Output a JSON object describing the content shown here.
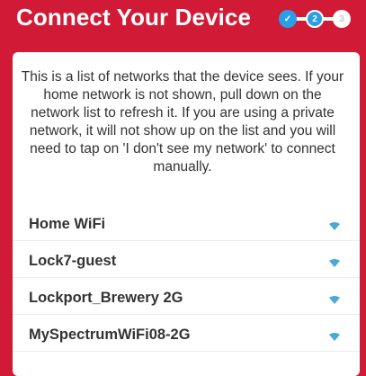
{
  "header": {
    "title": "Connect Your Device",
    "steps": [
      "✓",
      "2",
      "3"
    ]
  },
  "intro_text": "This is a list of networks that the device sees. If your home network is not shown, pull down on the network list to refresh it. If you are using a private network, it will not show up on the list and you will need to tap on 'I don't see my network' to connect manually.",
  "networks": [
    {
      "name": "Home WiFi",
      "icon": "wifi-signal-icon"
    },
    {
      "name": "Lock7-guest",
      "icon": "wifi-signal-icon"
    },
    {
      "name": "Lockport_Brewery 2G",
      "icon": "wifi-signal-icon"
    },
    {
      "name": "MySpectrumWiFi08-2G",
      "icon": "wifi-signal-icon"
    }
  ],
  "colors": {
    "brand_red": "#d11a36",
    "accent_blue": "#2a9fe8",
    "wifi_icon": "#4aa8d8"
  }
}
